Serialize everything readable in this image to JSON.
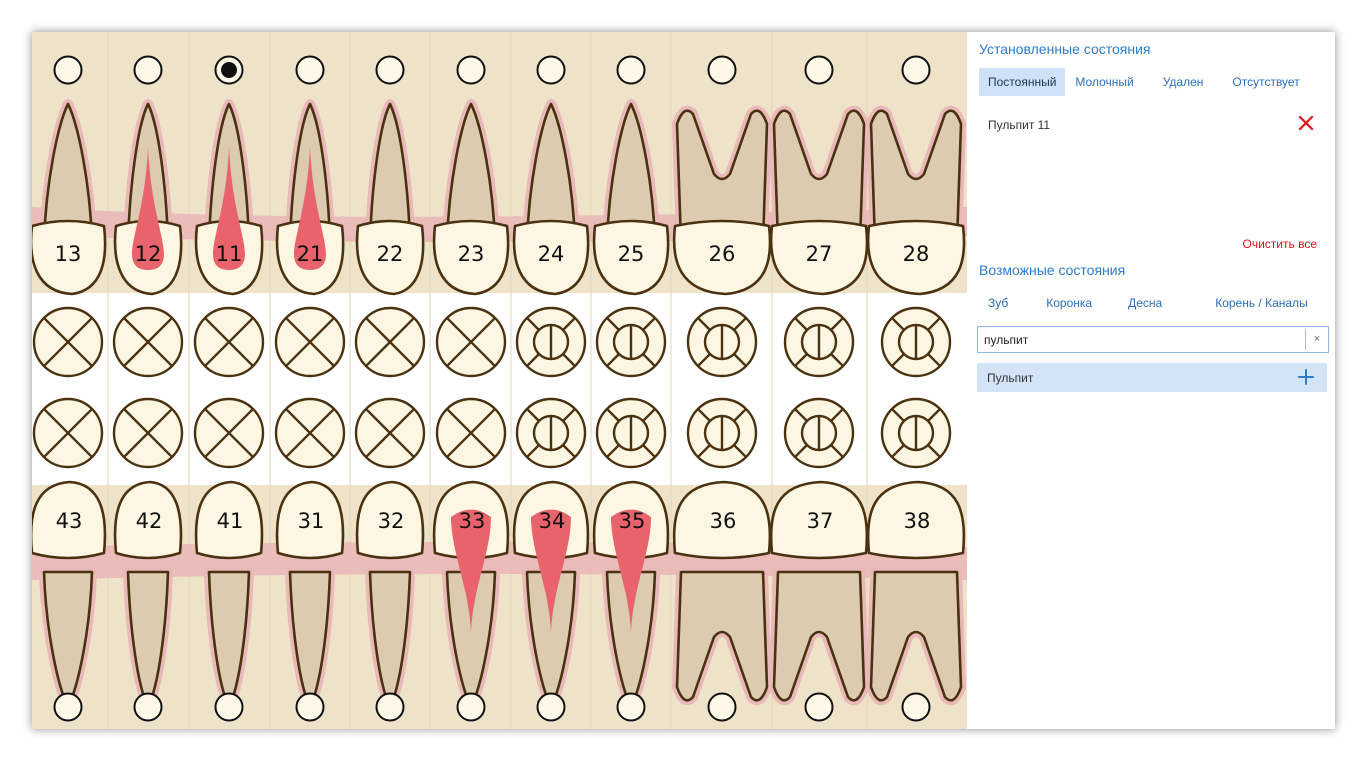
{
  "teeth": {
    "upper": [
      {
        "num": "13",
        "type": "canine",
        "pulp": false,
        "top_mark": "empty",
        "bottom_mark": "cross"
      },
      {
        "num": "12",
        "type": "incisor",
        "pulp": true,
        "top_mark": "empty",
        "bottom_mark": "cross"
      },
      {
        "num": "11",
        "type": "incisor",
        "pulp": true,
        "top_mark": "filled",
        "bottom_mark": "cross"
      },
      {
        "num": "21",
        "type": "incisor",
        "pulp": true,
        "top_mark": "empty",
        "bottom_mark": "cross"
      },
      {
        "num": "22",
        "type": "incisor",
        "pulp": false,
        "top_mark": "empty",
        "bottom_mark": "cross"
      },
      {
        "num": "23",
        "type": "canine",
        "pulp": false,
        "top_mark": "empty",
        "bottom_mark": "cross"
      },
      {
        "num": "24",
        "type": "premolar",
        "pulp": false,
        "top_mark": "empty",
        "bottom_mark": "surfaces"
      },
      {
        "num": "25",
        "type": "premolar",
        "pulp": false,
        "top_mark": "empty",
        "bottom_mark": "surfaces"
      },
      {
        "num": "26",
        "type": "molar",
        "pulp": false,
        "top_mark": "empty",
        "bottom_mark": "surfaces"
      },
      {
        "num": "27",
        "type": "molar",
        "pulp": false,
        "top_mark": "empty",
        "bottom_mark": "surfaces"
      },
      {
        "num": "28",
        "type": "molar",
        "pulp": false,
        "top_mark": "empty",
        "bottom_mark": "surfaces"
      }
    ],
    "lower": [
      {
        "num": "43",
        "type": "canine",
        "pulp": false,
        "top_mark": "cross",
        "bottom_mark": "empty"
      },
      {
        "num": "42",
        "type": "incisor",
        "pulp": false,
        "top_mark": "cross",
        "bottom_mark": "empty"
      },
      {
        "num": "41",
        "type": "incisor",
        "pulp": false,
        "top_mark": "cross",
        "bottom_mark": "empty"
      },
      {
        "num": "31",
        "type": "incisor",
        "pulp": false,
        "top_mark": "cross",
        "bottom_mark": "empty"
      },
      {
        "num": "32",
        "type": "incisor",
        "pulp": false,
        "top_mark": "cross",
        "bottom_mark": "empty"
      },
      {
        "num": "33",
        "type": "canine",
        "pulp": true,
        "top_mark": "cross",
        "bottom_mark": "empty"
      },
      {
        "num": "34",
        "type": "premolar",
        "pulp": true,
        "top_mark": "surfaces",
        "bottom_mark": "empty"
      },
      {
        "num": "35",
        "type": "premolar",
        "pulp": true,
        "top_mark": "surfaces",
        "bottom_mark": "empty"
      },
      {
        "num": "36",
        "type": "molar",
        "pulp": false,
        "top_mark": "surfaces",
        "bottom_mark": "empty"
      },
      {
        "num": "37",
        "type": "molar",
        "pulp": false,
        "top_mark": "surfaces",
        "bottom_mark": "empty"
      },
      {
        "num": "38",
        "type": "molar",
        "pulp": false,
        "top_mark": "surfaces",
        "bottom_mark": "empty"
      }
    ]
  },
  "colors": {
    "chart_bg": "#eee3c8",
    "gum": "#e9b8b8",
    "root": "#dccbb0",
    "crown": "#fdf6e2",
    "outline": "#4a3210",
    "pulp": "#e8636c"
  },
  "installed": {
    "title": "Установленные состояния",
    "tabs": [
      {
        "label": "Постоянный",
        "active": true
      },
      {
        "label": "Молочный",
        "active": false
      },
      {
        "label": "Удален",
        "active": false
      },
      {
        "label": "Отсутствует",
        "active": false
      }
    ],
    "items": [
      {
        "label": "Пульпит 11",
        "icon": "close-icon"
      }
    ],
    "clear_label": "Очистить все"
  },
  "possible": {
    "title": "Возможные состояния",
    "tabs": [
      {
        "label": "Зуб"
      },
      {
        "label": "Коронка"
      },
      {
        "label": "Десна"
      },
      {
        "label": "Корень / Каналы"
      }
    ],
    "search": {
      "value": "пульпит",
      "placeholder": "",
      "clear_label": "×"
    },
    "results": [
      {
        "label": "Пульпит",
        "icon": "plus-icon"
      }
    ]
  }
}
